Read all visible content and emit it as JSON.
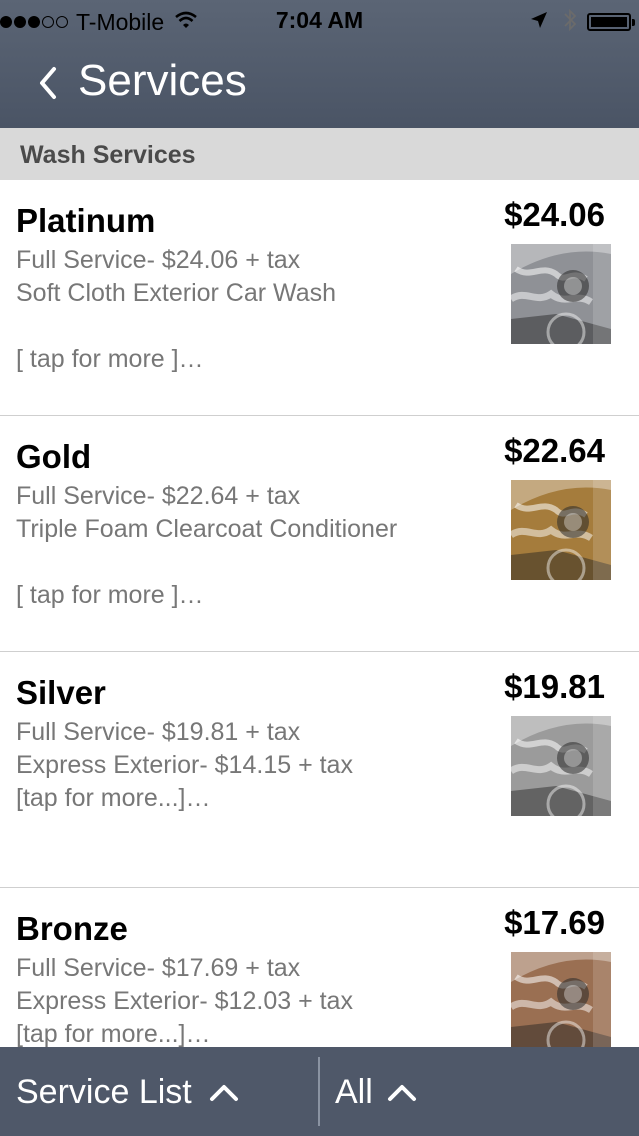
{
  "status_bar": {
    "carrier": "T-Mobile",
    "time": "7:04 AM",
    "signal_bars": 3,
    "signal_total": 5
  },
  "nav": {
    "title": "Services"
  },
  "section": {
    "title": "Wash Services"
  },
  "services": [
    {
      "name": "Platinum",
      "price": "$24.06",
      "line1": "Full Service- $24.06 + tax",
      "line2": "Soft Cloth Exterior Car Wash",
      "line3": "[ tap for more ]…",
      "tint": "#8f9196"
    },
    {
      "name": "Gold",
      "price": "$22.64",
      "line1": "Full Service- $22.64 + tax",
      "line2": "Triple Foam Clearcoat Conditioner",
      "line3": "[ tap for more ]…",
      "tint": "#a57c3c"
    },
    {
      "name": "Silver",
      "price": "$19.81",
      "line1": "Full Service- $19.81 + tax",
      "line2": "Express Exterior- $14.15 + tax",
      "line3": "[tap for more...]…",
      "tint": "#9b9b9b"
    },
    {
      "name": "Bronze",
      "price": "$17.69",
      "line1": "Full Service- $17.69 + tax",
      "line2": "Express Exterior- $12.03 + tax",
      "line3": "[tap for more...]…",
      "tint": "#9a6f52"
    }
  ],
  "bottom_bar": {
    "filter_label": "Service List",
    "category_label": "All"
  },
  "colors": {
    "nav_bg": "#4a5465",
    "section_bg": "#d9d9d9",
    "bottom_bar_bg": "#4f5869"
  }
}
